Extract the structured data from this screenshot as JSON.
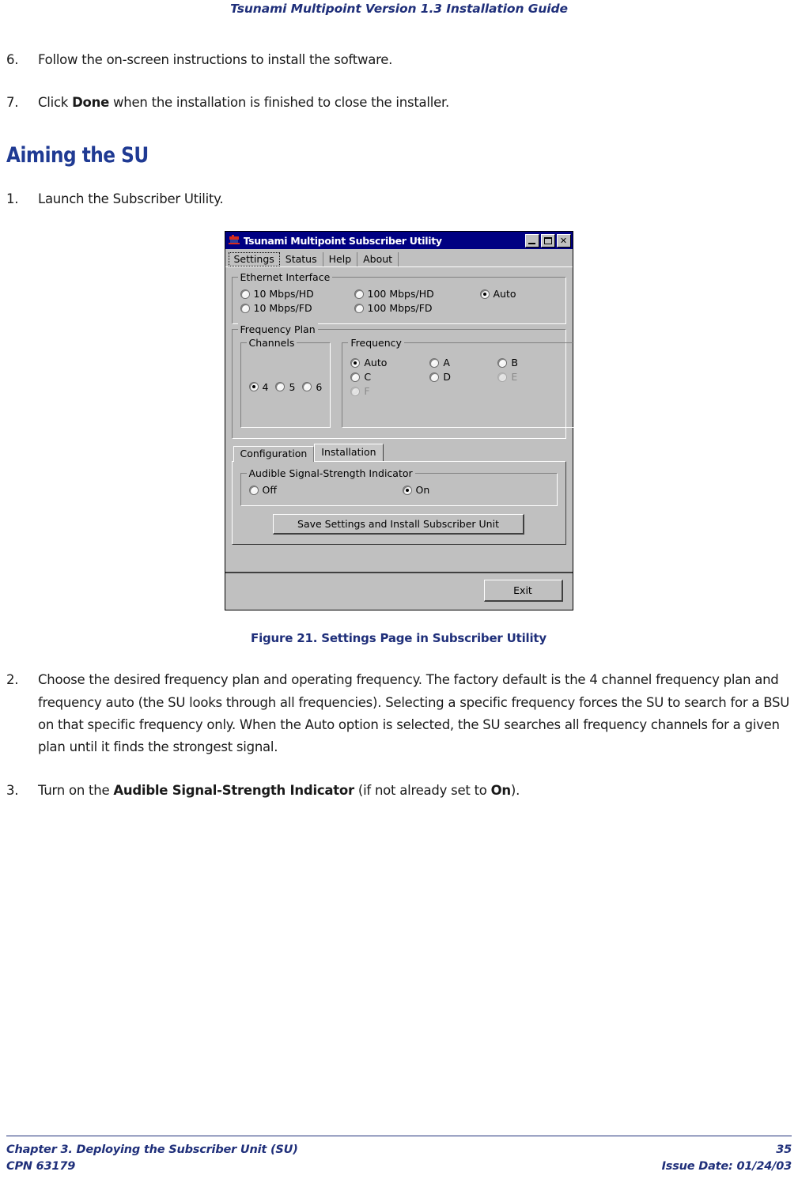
{
  "header": {
    "running_head": "Tsunami Multipoint Version 1.3 Installation Guide"
  },
  "body": {
    "steps": [
      {
        "number": "6.",
        "text_before": "Follow the on-screen instructions to install the software.",
        "bold": "",
        "text_after": ""
      },
      {
        "number": "7.",
        "text_before": "Click ",
        "bold": "Done",
        "text_after": " when the installation is finished to close the installer."
      }
    ],
    "section_heading": "Aiming the SU",
    "step1": {
      "number": "1.",
      "text": "Launch the Subscriber Utility."
    },
    "figure_caption": "Figure 21.  Settings Page in Subscriber Utility",
    "step2": {
      "number": "2.",
      "text": "Choose the desired frequency plan and operating frequency.  The factory default is the 4 channel frequency plan and frequency auto (the SU looks through all frequencies).  Selecting a specific frequency forces the SU to search for a BSU on that specific frequency only.  When the Auto option is selected, the SU searches all frequency channels for a given plan until it finds the strongest signal."
    },
    "step3": {
      "number": "3.",
      "text_before": "Turn on the ",
      "bold1": "Audible Signal-Strength Indicator",
      "text_mid": " (if not already set to ",
      "bold2": "On",
      "text_after": ")."
    }
  },
  "dialog": {
    "title": "Tsunami Multipoint Subscriber Utility",
    "window_buttons": {
      "minimize": "minimize-icon",
      "maximize": "maximize-icon",
      "close": "✕"
    },
    "tabs": [
      {
        "label": "Settings",
        "active": true
      },
      {
        "label": "Status",
        "active": false
      },
      {
        "label": "Help",
        "active": false
      },
      {
        "label": "About",
        "active": false
      }
    ],
    "ethernet_group": {
      "title": "Ethernet Interface",
      "options": [
        {
          "label": "10 Mbps/HD",
          "selected": false,
          "disabled": false
        },
        {
          "label": "100 Mbps/HD",
          "selected": false,
          "disabled": false
        },
        {
          "label": "Auto",
          "selected": true,
          "disabled": false
        },
        {
          "label": "10 Mbps/FD",
          "selected": false,
          "disabled": false
        },
        {
          "label": "100 Mbps/FD",
          "selected": false,
          "disabled": false
        }
      ]
    },
    "frequency_plan_group": {
      "title": "Frequency Plan",
      "channels": {
        "title": "Channels",
        "options": [
          {
            "label": "4",
            "selected": true,
            "disabled": false
          },
          {
            "label": "5",
            "selected": false,
            "disabled": false
          },
          {
            "label": "6",
            "selected": false,
            "disabled": false
          }
        ]
      },
      "frequency": {
        "title": "Frequency",
        "options": [
          {
            "label": "Auto",
            "selected": true,
            "disabled": false
          },
          {
            "label": "A",
            "selected": false,
            "disabled": false
          },
          {
            "label": "B",
            "selected": false,
            "disabled": false
          },
          {
            "label": "C",
            "selected": false,
            "disabled": false
          },
          {
            "label": "D",
            "selected": false,
            "disabled": false
          },
          {
            "label": "E",
            "selected": false,
            "disabled": true
          },
          {
            "label": "F",
            "selected": false,
            "disabled": true
          }
        ]
      }
    },
    "inner_tabs": [
      {
        "label": "Configuration",
        "active": false
      },
      {
        "label": "Installation",
        "active": true
      }
    ],
    "audible_group": {
      "title": "Audible Signal-Strength Indicator",
      "options": [
        {
          "label": "Off",
          "selected": false
        },
        {
          "label": "On",
          "selected": true
        }
      ]
    },
    "save_button": "Save Settings and Install Subscriber Unit",
    "exit_button": "Exit"
  },
  "footer": {
    "chapter": "Chapter 3.  Deploying the Subscriber Unit (SU)",
    "page_number": "35",
    "cpn": "CPN 63179",
    "issue_date": "Issue Date:  01/24/03"
  },
  "colors": {
    "heading_blue": "#1f3a93",
    "navy": "#1f2f7a",
    "titlebar": "#000082",
    "dialog_face": "#c0c0c0"
  }
}
